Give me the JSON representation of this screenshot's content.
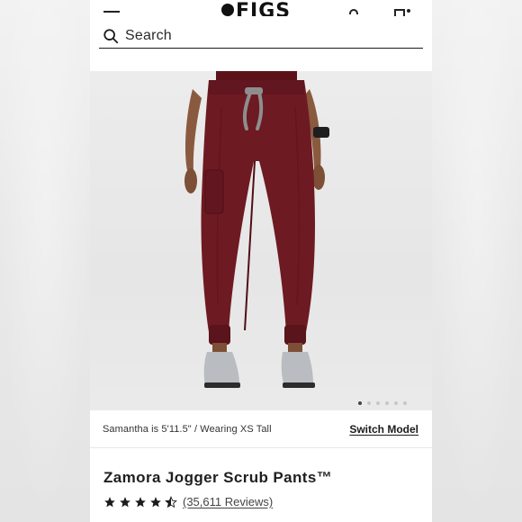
{
  "header": {
    "brand": "FIGS",
    "search_placeholder": "Search"
  },
  "gallery": {
    "image_alt": "Model wearing burgundy jogger scrub pants",
    "slide_count": 6,
    "active_slide": 1
  },
  "model": {
    "info": "Samantha is 5'11.5\" / Wearing XS Tall",
    "switch_label": "Switch Model"
  },
  "product": {
    "title": "Zamora Jogger Scrub Pants™",
    "rating": 4.5,
    "rating_max": 5,
    "reviews_label": "(35,611 Reviews)"
  },
  "colors": {
    "pant": "#6e1a22",
    "accent_text": "#1b1b1b"
  }
}
